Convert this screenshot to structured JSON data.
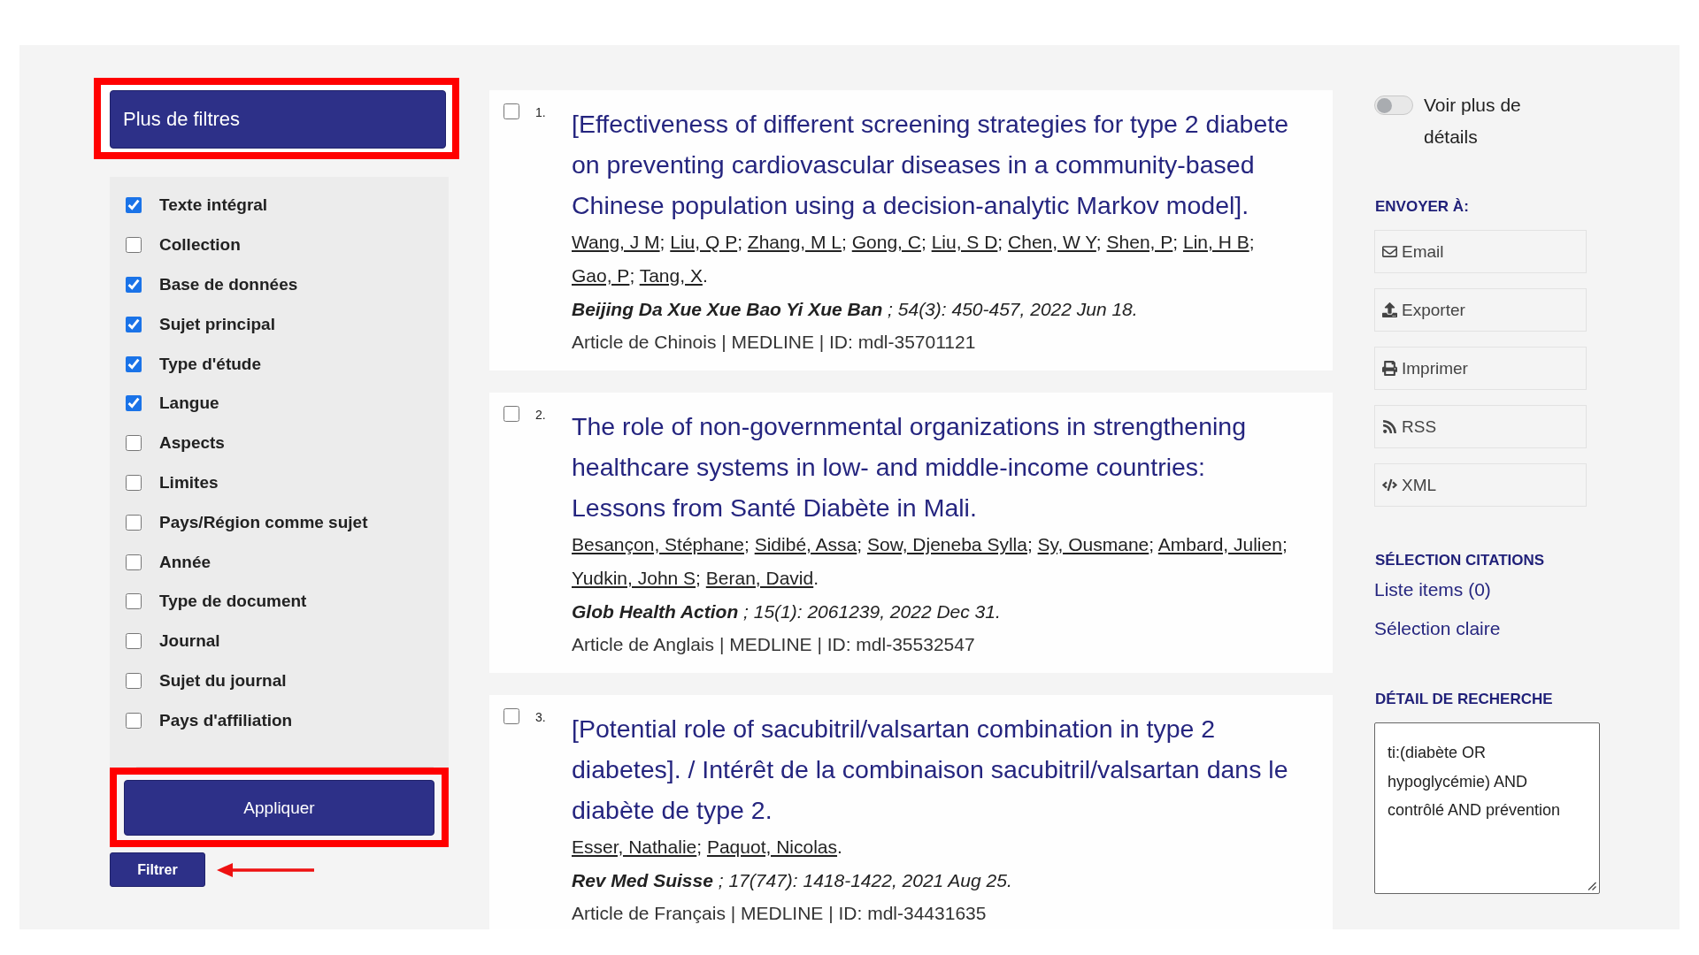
{
  "filters_panel": {
    "more_filters_button": {
      "label": "Plus de filtres",
      "highlighted": true
    },
    "filters": [
      {
        "label": "Texte intégral",
        "checked": true
      },
      {
        "label": "Collection",
        "checked": false
      },
      {
        "label": "Base de données",
        "checked": true
      },
      {
        "label": "Sujet principal",
        "checked": true
      },
      {
        "label": "Type d'étude",
        "checked": true
      },
      {
        "label": "Langue",
        "checked": true
      },
      {
        "label": "Aspects",
        "checked": false
      },
      {
        "label": "Limites",
        "checked": false
      },
      {
        "label": "Pays/Région comme sujet",
        "checked": false
      },
      {
        "label": "Année",
        "checked": false
      },
      {
        "label": "Type de document",
        "checked": false
      },
      {
        "label": "Journal",
        "checked": false
      },
      {
        "label": "Sujet du journal",
        "checked": false
      },
      {
        "label": "Pays d'affiliation",
        "checked": false
      }
    ],
    "apply_button": {
      "label": "Appliquer",
      "highlighted": true
    },
    "filter_button": {
      "label": "Filtrer",
      "arrow": true
    }
  },
  "results": [
    {
      "number": "1.",
      "checked": false,
      "title": "[Effectiveness of different screening strategies for type 2 diabete on preventing cardiovascular diseases in a community-based Chinese population using a decision-analytic Markov model].",
      "authors": [
        {
          "name": "Wang, J M",
          "punct": ";"
        },
        {
          "name": "Liu, Q P",
          "punct": ";"
        },
        {
          "name": "Zhang, M L",
          "punct": ";"
        },
        {
          "name": "Gong, C",
          "punct": ";"
        },
        {
          "name": "Liu, S D",
          "punct": ";"
        },
        {
          "name": "Chen, W Y",
          "punct": ";"
        },
        {
          "name": "Shen, P",
          "punct": ";"
        },
        {
          "name": "Lin, H B",
          "punct": ";"
        },
        {
          "name": "Gao, P",
          "punct": ";"
        },
        {
          "name": "Tang, X",
          "punct": "."
        }
      ],
      "source": "**Beijing Da Xue Xue Bao Yi Xue Ban** ; 54(3): 450-457, 2022 Jun 18.",
      "meta": "Article de Chinois | MEDLINE | ID: mdl-35701121"
    },
    {
      "number": "2.",
      "checked": false,
      "title": "The role of non-governmental organizations in strengthening healthcare systems in low- and middle-income countries: Lessons from Santé Diabète in Mali.",
      "authors": [
        {
          "name": "Besançon, Stéphane",
          "punct": ";"
        },
        {
          "name": "Sidibé, Assa",
          "punct": ";"
        },
        {
          "name": "Sow, Djeneba Sylla",
          "punct": ";"
        },
        {
          "name": "Sy, Ousmane",
          "punct": ";"
        },
        {
          "name": "Ambard, Julien",
          "punct": ";"
        },
        {
          "name": "Yudkin, John S",
          "punct": ";"
        },
        {
          "name": "Beran, David",
          "punct": "."
        }
      ],
      "source": "**Glob Health Action** ; 15(1): 2061239, 2022 Dec 31.",
      "meta": "Article de Anglais | MEDLINE | ID: mdl-35532547"
    },
    {
      "number": "3.",
      "checked": false,
      "title": "[Potential role of sacubitril/valsartan combination in type 2 diabetes]. / Intérêt de la combinaison sacubitril/valsartan dans le diabète de type 2.",
      "authors": [
        {
          "name": "Esser, Nathalie",
          "punct": ";"
        },
        {
          "name": "Paquot, Nicolas",
          "punct": "."
        }
      ],
      "source": "**Rev Med Suisse** ; 17(747): 1418-1422, 2021 Aug 25.",
      "meta": "Article de Français | MEDLINE | ID: mdl-34431635"
    }
  ],
  "sidebar": {
    "details_toggle": {
      "label": "Voir plus de détails",
      "on": false
    },
    "send_to": {
      "heading": "ENVOYER À:",
      "buttons": [
        {
          "label": "Email",
          "kind": "email"
        },
        {
          "label": "Exporter",
          "kind": "export"
        },
        {
          "label": "Imprimer",
          "kind": "print"
        },
        {
          "label": "RSS",
          "kind": "rss"
        },
        {
          "label": "XML",
          "kind": "xml"
        }
      ]
    },
    "citation_selection": {
      "heading": "SÉLECTION CITATIONS",
      "links": [
        "Liste items (0)",
        "Sélection claire"
      ]
    },
    "search_detail": {
      "heading": "DÉTAIL DE RECHERCHE",
      "query": "ti:(diabète OR hypoglycémie) AND contrôlé AND prévention"
    }
  }
}
